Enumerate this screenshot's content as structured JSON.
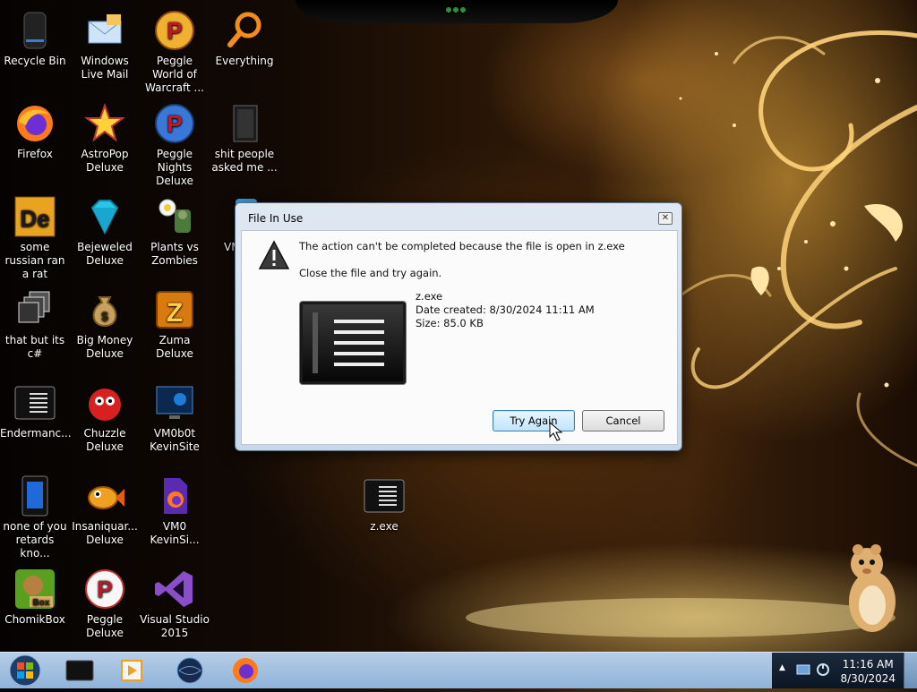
{
  "desktop": {
    "icons": [
      {
        "name": "recycle-bin-icon",
        "label": "Recycle Bin"
      },
      {
        "name": "windows-live-mail-icon",
        "label": "Windows Live Mail"
      },
      {
        "name": "peggle-world-of-warcraft-icon",
        "label": "Peggle World of Warcraft ..."
      },
      {
        "name": "everything-search-icon",
        "label": "Everything"
      },
      {
        "name": "firefox-icon",
        "label": "Firefox"
      },
      {
        "name": "astropop-icon",
        "label": "AstroPop Deluxe"
      },
      {
        "name": "peggle-nights-icon",
        "label": "Peggle Nights Deluxe"
      },
      {
        "name": "folder-shortcut-icon",
        "label": "shit people asked me ..."
      },
      {
        "name": "de-app-icon",
        "label": "some russian ran a rat"
      },
      {
        "name": "bejeweled-icon",
        "label": "Bejeweled Deluxe"
      },
      {
        "name": "plants-vs-zombies-icon",
        "label": "Plants vs Zombies"
      },
      {
        "name": "vmware-icon",
        "label": "VM Wor"
      },
      {
        "name": "windows-stack-icon",
        "label": "that but its c#"
      },
      {
        "name": "big-money-icon",
        "label": "Big Money Deluxe"
      },
      {
        "name": "zuma-icon",
        "label": "Zuma Deluxe"
      },
      {
        "name": "endermanch-icon",
        "label": "Endermanc..."
      },
      {
        "name": "chuzzle-icon",
        "label": "Chuzzle Deluxe"
      },
      {
        "name": "vm0b0t-icon",
        "label": "VM0b0t KevinSite"
      },
      {
        "name": "tablet-app-icon",
        "label": "none of you retards kno..."
      },
      {
        "name": "insaniquarium-icon",
        "label": "Insaniquar... Deluxe"
      },
      {
        "name": "firefox-file-icon",
        "label": "VM0 KevinSi..."
      },
      {
        "name": "chomikbox-icon",
        "label": "ChomikBox"
      },
      {
        "name": "peggle-deluxe-icon",
        "label": "Peggle Deluxe"
      },
      {
        "name": "visual-studio-icon",
        "label": "Visual Studio 2015"
      },
      {
        "name": "zexe-icon",
        "label": "z.exe"
      }
    ]
  },
  "dialog": {
    "title": "File In Use",
    "close_symbol": "✕",
    "message": "The action can't be completed because the file is open in z.exe",
    "instruction": "Close the file and try again.",
    "file_name": "z.exe",
    "date_created": "Date created: 8/30/2024 11:11 AM",
    "size": "Size: 85.0 KB",
    "try_again_label": "Try Again",
    "cancel_label": "Cancel"
  },
  "taskbar": {
    "time": "11:16 AM",
    "date": "8/30/2024"
  }
}
